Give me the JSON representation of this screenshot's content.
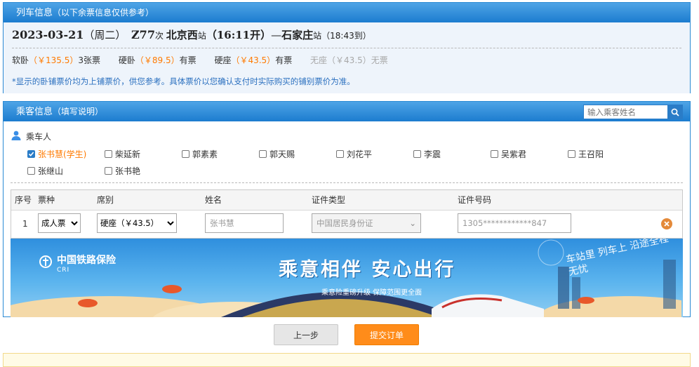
{
  "train_panel": {
    "title": "列车信息",
    "subtitle": "（以下余票信息仅供参考）",
    "date": "2023-03-21",
    "weekday": "（周二）",
    "train_no": "Z77",
    "train_suffix": "次",
    "from_station": "北京西",
    "station_suffix": "站",
    "depart_time": "（16:11开）",
    "dash": "—",
    "to_station": "石家庄",
    "to_suffix": "站",
    "arrive_time": "（18:43到）",
    "seats": [
      {
        "name": "软卧",
        "price": "（￥135.5）",
        "status": "3张票",
        "gray": false
      },
      {
        "name": "硬卧",
        "price": "（￥89.5）",
        "status": "有票",
        "gray": false
      },
      {
        "name": "硬座",
        "price": "（￥43.5）",
        "status": "有票",
        "gray": false
      },
      {
        "name": "无座",
        "price": "（￥43.5）",
        "status": "无票",
        "gray": true
      }
    ],
    "note": "*显示的卧铺票价均为上铺票价，供您参考。具体票价以您确认支付时实际购买的铺别票价为准。"
  },
  "passenger_panel": {
    "title": "乘客信息",
    "subtitle": "（填写说明）",
    "search_placeholder": "输入乘客姓名",
    "section_label": "乘车人",
    "passengers": [
      {
        "name": "张书慧(学生)",
        "checked": true
      },
      {
        "name": "柴延新",
        "checked": false
      },
      {
        "name": "郭素素",
        "checked": false
      },
      {
        "name": "郭天赐",
        "checked": false
      },
      {
        "name": "刘花平",
        "checked": false
      },
      {
        "name": "李震",
        "checked": false
      },
      {
        "name": "吴紫君",
        "checked": false
      },
      {
        "name": "王召阳",
        "checked": false
      },
      {
        "name": "张继山",
        "checked": false
      },
      {
        "name": "张书艳",
        "checked": false
      }
    ],
    "table_headers": [
      "序号",
      "票种",
      "席别",
      "姓名",
      "证件类型",
      "证件号码"
    ],
    "row": {
      "index": "1",
      "ticket_type": "成人票",
      "seat_type": "硬座（￥43.5）",
      "name": "张书慧",
      "id_type": "中国居民身份证",
      "id_number": "1305************847"
    }
  },
  "banner": {
    "brand": "中国铁路保险",
    "brand_en": "CRI",
    "slogan": "乘意相伴 安心出行",
    "sub": "乘意险重磅升级 保障范围更全面",
    "verse": "车站里 列车上 沿途全程无忧"
  },
  "buttons": {
    "prev": "上一步",
    "submit": "提交订单"
  },
  "colors": {
    "header_blue": "#1c7ccf",
    "price_orange": "#ff7a00",
    "submit_orange": "#ff8c1a",
    "note_blue": "#2a6fbf"
  }
}
